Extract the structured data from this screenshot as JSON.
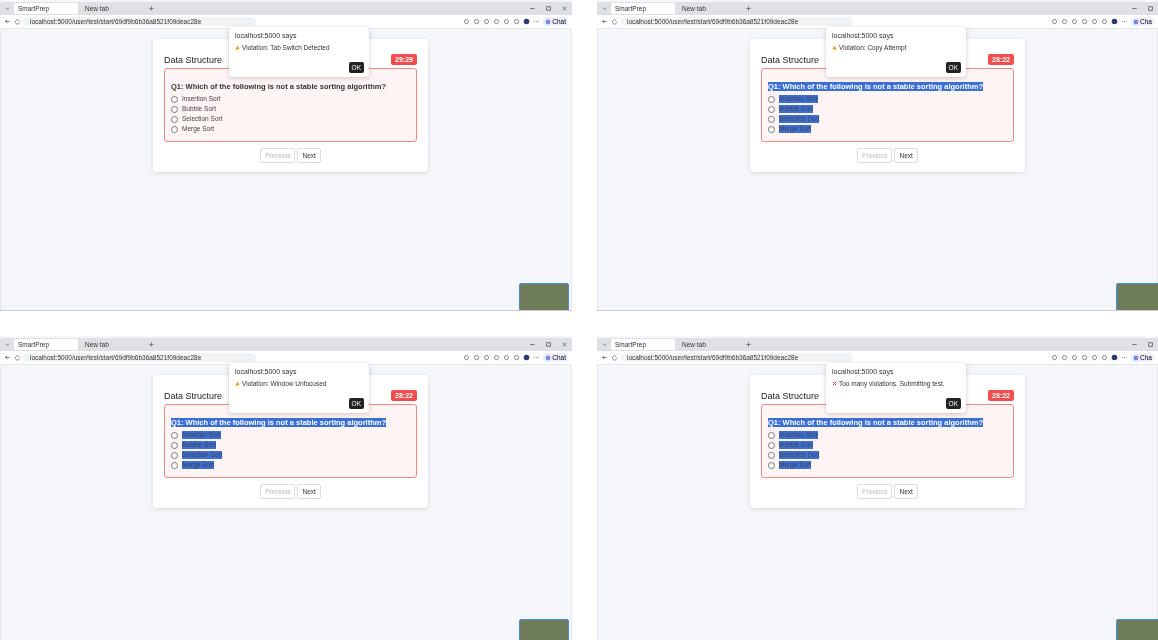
{
  "panels": [
    {
      "tabs": [
        {
          "label": "SmartPrep",
          "selected": true
        },
        {
          "label": "New tab",
          "selected": false
        }
      ],
      "url": "localhost:5000/user/test/start/69df9b6b36a8521f09deac28e",
      "chat_label": "Chat",
      "close_visible": true,
      "quiz_title": "Data Structure",
      "timer": "29:29",
      "question": {
        "text": "Q1: Which of the following is not a stable sorting algorithm?",
        "highlighted": false,
        "options": [
          {
            "label": "Insertion Sort",
            "selected": false
          },
          {
            "label": "Bubble Sort",
            "selected": false
          },
          {
            "label": "Selection Sort",
            "selected": false
          },
          {
            "label": "Merge Sort",
            "selected": false
          }
        ]
      },
      "buttons": [
        {
          "label": "Previous",
          "disabled": true
        },
        {
          "label": "Next",
          "disabled": false
        }
      ],
      "dialog": {
        "origin": "localhost:5000 says",
        "kind": "warning",
        "message": "Violation: Tab Switch Detected",
        "button": "OK"
      }
    },
    {
      "tabs": [
        {
          "label": "SmartPrep",
          "selected": true
        },
        {
          "label": "New tab",
          "selected": false
        }
      ],
      "url": "localhost:5000/user/test/start/69df9b6b36a8521f09deac28e",
      "chat_label": "Cha",
      "close_visible": false,
      "quiz_title": "Data Structure",
      "timer": "28:22",
      "question": {
        "text": "Q1: Which of the following is not a stable sorting algorithm?",
        "highlighted": true,
        "options": [
          {
            "label": "Insertion Sort",
            "selected": false
          },
          {
            "label": "Bubble Sort",
            "selected": false
          },
          {
            "label": "Selection Sort",
            "selected": false
          },
          {
            "label": "Merge Sort",
            "selected": false
          }
        ]
      },
      "buttons": [
        {
          "label": "Previous",
          "disabled": true
        },
        {
          "label": "Next",
          "disabled": false
        }
      ],
      "dialog": {
        "origin": "localhost:5000 says",
        "kind": "warning",
        "message": "Violation: Copy Attempt",
        "button": "OK"
      }
    },
    {
      "tabs": [
        {
          "label": "SmartPrep",
          "selected": true
        },
        {
          "label": "New tab",
          "selected": false
        }
      ],
      "url": "localhost:5000/user/test/start/69df9b6b36a8521f09deac28e",
      "chat_label": "Chat",
      "close_visible": true,
      "quiz_title": "Data Structure",
      "timer": "28:22",
      "question": {
        "text": "Q1: Which of the following is not a stable sorting algorithm?",
        "highlighted": true,
        "options": [
          {
            "label": "Insertion Sort",
            "selected": false
          },
          {
            "label": "Bubble Sort",
            "selected": false
          },
          {
            "label": "Selection Sort",
            "selected": false
          },
          {
            "label": "Merge Sort",
            "selected": false
          }
        ]
      },
      "buttons": [
        {
          "label": "Previous",
          "disabled": true
        },
        {
          "label": "Next",
          "disabled": false
        }
      ],
      "dialog": {
        "origin": "localhost:5000 says",
        "kind": "warning",
        "message": "Violation: Window Unfocused",
        "button": "OK"
      }
    },
    {
      "tabs": [
        {
          "label": "SmartPrep",
          "selected": true
        },
        {
          "label": "New tab",
          "selected": false
        }
      ],
      "url": "localhost:5000/user/test/start/69df9b6b36a8521f09deac28e",
      "chat_label": "Cha",
      "close_visible": false,
      "quiz_title": "Data Structure",
      "timer": "28:22",
      "question": {
        "text": "Q1: Which of the following is not a stable sorting algorithm?",
        "highlighted": true,
        "options": [
          {
            "label": "Insertion Sort",
            "selected": false
          },
          {
            "label": "Bubble Sort",
            "selected": false
          },
          {
            "label": "Selection Sort",
            "selected": false
          },
          {
            "label": "Merge Sort",
            "selected": false
          }
        ]
      },
      "buttons": [
        {
          "label": "Previous",
          "disabled": true
        },
        {
          "label": "Next",
          "disabled": false
        }
      ],
      "dialog": {
        "origin": "localhost:5000 says",
        "kind": "error",
        "message": "Too many violations. Submitting test.",
        "button": "OK"
      }
    }
  ]
}
